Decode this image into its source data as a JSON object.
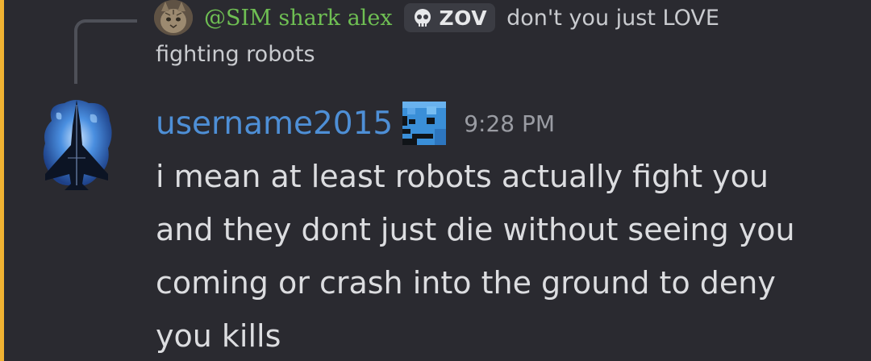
{
  "reply": {
    "author": "@SIM shark alex",
    "clan_tag": "ZOV",
    "clan_icon": "skull-icon",
    "text_line1": "don't you just LOVE",
    "text_line2": "fighting robots"
  },
  "message": {
    "username": "username2015",
    "role_icon": "pixel-face-icon",
    "timestamp": "9:28 PM",
    "content_lines": [
      "i mean at least robots actually fight you",
      "and they dont just die without seeing you",
      "coming or crash into the ground to deny",
      "you kills"
    ]
  },
  "colors": {
    "background": "#2a2a30",
    "highlight_bar": "#f0b232",
    "username": "#4e8fd6",
    "reply_author": "#6fbf53",
    "timestamp": "#9a9ca3"
  }
}
